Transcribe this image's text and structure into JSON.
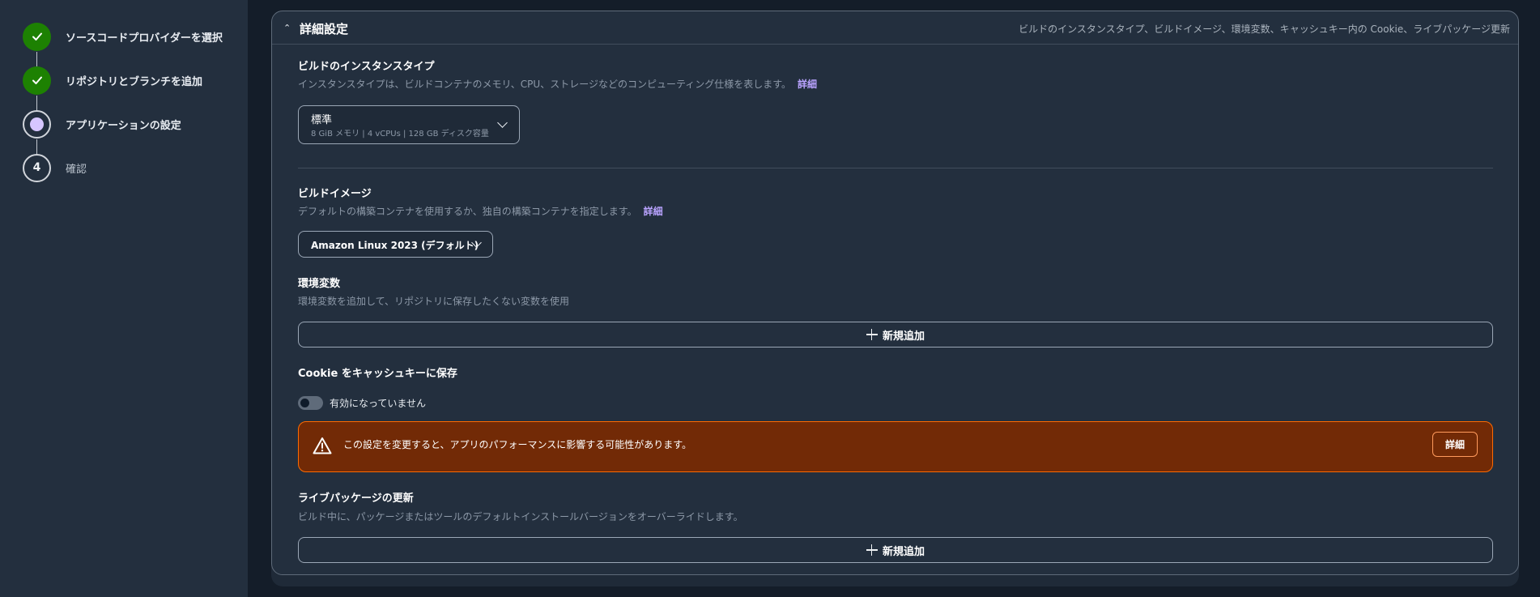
{
  "wizard": {
    "steps": [
      {
        "label": "ソースコードプロバイダーを選択",
        "status": "completed",
        "icon": "check-icon"
      },
      {
        "label": "リポジトリとブランチを追加",
        "status": "completed",
        "icon": "check-icon"
      },
      {
        "label": "アプリケーションの設定",
        "status": "current",
        "icon": "dot-icon"
      },
      {
        "label": "確認",
        "status": "pending",
        "number": "4"
      }
    ]
  },
  "advanced": {
    "title": "詳細設定",
    "summary": "ビルドのインスタンスタイプ、ビルドイメージ、環境変数、キャッシュキー内の Cookie、ライブパッケージ更新",
    "expanded": true
  },
  "instance_type": {
    "title": "ビルドのインスタンスタイプ",
    "description": "インスタンスタイプは、ビルドコンテナのメモリ、CPU、ストレージなどのコンピューティング仕様を表します。",
    "link": "詳細",
    "selected": "標準",
    "selected_detail": "8 GiB メモリ | 4 vCPUs | 128 GB ディスク容量"
  },
  "build_image": {
    "title": "ビルドイメージ",
    "description": "デフォルトの構築コンテナを使用するか、独自の構築コンテナを指定します。",
    "link": "詳細",
    "selected": "Amazon Linux 2023 (デフォルト)"
  },
  "env_vars": {
    "title": "環境変数",
    "description": "環境変数を追加して、リポジトリに保存したくない変数を使用",
    "add_label": "新規追加"
  },
  "cookie_cache": {
    "title": "Cookie をキャッシュキーに保存",
    "toggle_label": "有効になっていません",
    "enabled": false
  },
  "alert": {
    "message": "この設定を変更すると、アプリのパフォーマンスに影響する可能性があります。",
    "button": "詳細"
  },
  "live_packages": {
    "title": "ライブパッケージの更新",
    "description": "ビルド中に、パッケージまたはツールのデフォルトインストールバージョンをオーバーライドします。",
    "add_label": "新規追加"
  },
  "colors": {
    "background": "#141d29",
    "panel": "#232f3e",
    "success": "#1d8102",
    "current_step": "#d6c6ff",
    "link": "#b9a3ff",
    "warning_bg": "#722a06",
    "warning_border": "#ff6a00"
  }
}
